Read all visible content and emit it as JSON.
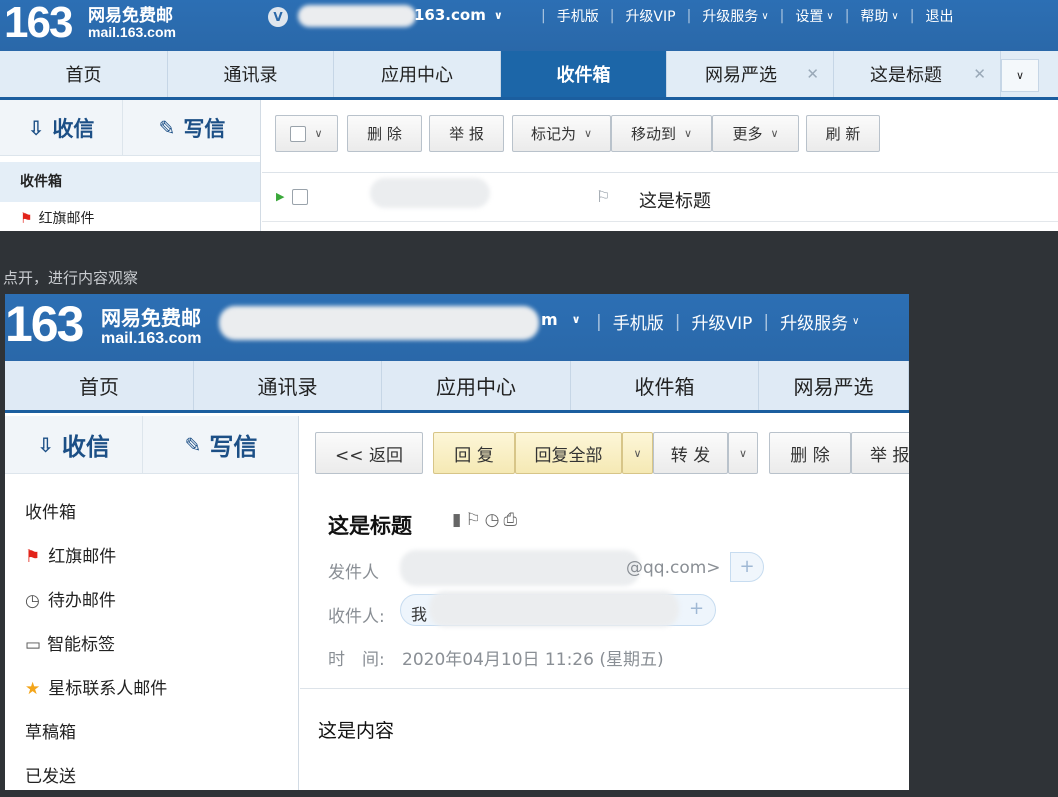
{
  "top": {
    "logo_num": "163",
    "logo_cn": "网易免费邮",
    "logo_en": "mail.163.com",
    "account_visible": "163.com",
    "nav": [
      "手机版",
      "升级VIP",
      "升级服务",
      "设置",
      "帮助",
      "退出"
    ],
    "tabs": [
      "首页",
      "通讯录",
      "应用中心",
      "收件箱",
      "网易严选",
      "这是标题"
    ],
    "receive": "收信",
    "write": "写信",
    "sidebar": [
      "收件箱",
      "红旗邮件"
    ],
    "toolbar": [
      "删 除",
      "举 报",
      "标记为",
      "移动到",
      "更多",
      "刷 新"
    ],
    "mail_subject": "这是标题"
  },
  "caption": "点开，进行内容观察",
  "bottom": {
    "logo_num": "163",
    "logo_cn": "网易免费邮",
    "logo_en": "mail.163.com",
    "account_visible": "m",
    "nav": [
      "手机版",
      "升级VIP",
      "升级服务"
    ],
    "tabs": [
      "首页",
      "通讯录",
      "应用中心",
      "收件箱",
      "网易严选"
    ],
    "receive": "收信",
    "write": "写信",
    "sidebar": [
      "收件箱",
      "红旗邮件",
      "待办邮件",
      "智能标签",
      "星标联系人邮件",
      "草稿箱",
      "已发送"
    ],
    "toolbar": [
      "<< 返回",
      "回 复",
      "回复全部",
      "转 发",
      "删 除",
      "举 报"
    ],
    "subject": "这是标题",
    "sender_label": "发件人",
    "sender_visible": "@qq.com>",
    "recipient_label": "收件人:",
    "recipient_visible": "我",
    "time_label": "时　间:",
    "time_value": "2020年04月10日 11:26 (星期五)",
    "body": "这是内容"
  },
  "colors": {
    "header_blue": "#2a6aac",
    "tab_active": "#1c66a8",
    "dark_bg": "#2f3337"
  }
}
